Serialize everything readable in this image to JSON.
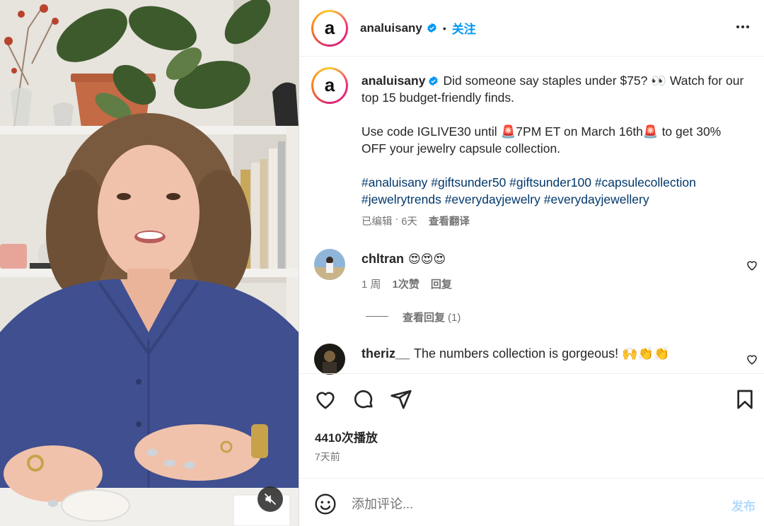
{
  "post": {
    "author": "analuisany",
    "avatar_letter": "a",
    "follow_label": "关注",
    "separator": "•",
    "caption": {
      "line1_text": "Did someone say staples under $75? 👀 Watch for our top 15 budget-friendly finds.",
      "line2_text": "Use code IGLIVE30 until 🚨7PM ET on March 16th🚨 to get 30% OFF your jewelry capsule collection.",
      "hashtags": "#analuisany #giftsunder50 #giftsunder100 #capsulecollection #jewelrytrends #everydayjewelry #everydayjewellery"
    },
    "caption_meta": {
      "edited": "已编辑",
      "dot": "·",
      "age": "6天",
      "see_translation": "查看翻译"
    },
    "comments": [
      {
        "username": "chltran",
        "text": "😍😍😍",
        "age": "1 周",
        "likes": "1次赞",
        "reply": "回复",
        "view_replies": "查看回复",
        "reply_count": "(1)"
      },
      {
        "username": "theriz__",
        "text": "The numbers collection is gorgeous! 🙌👏👏"
      }
    ],
    "plays": "4410次播放",
    "posted_ago": "7天前",
    "add_comment": {
      "placeholder": "添加评论...",
      "post_label": "发布"
    }
  },
  "icons": {
    "verified": "verified-badge-icon",
    "more": "more-horizontal-icon",
    "like": "heart-icon",
    "comment": "comment-bubble-icon",
    "share": "paper-plane-icon",
    "save": "bookmark-icon",
    "emoji": "emoji-smile-icon",
    "mute": "speaker-muted-icon"
  },
  "colors": {
    "link_blue": "#0095f6",
    "hashtag_blue": "#00376b",
    "muted_text": "#737373",
    "post_disabled": "#b3dbff"
  }
}
